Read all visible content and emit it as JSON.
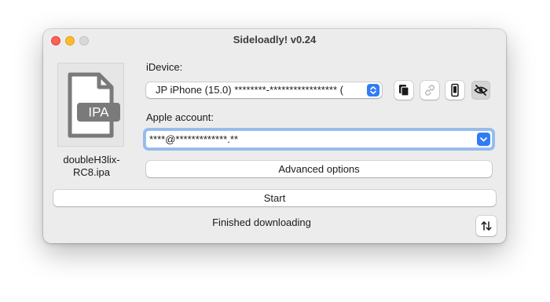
{
  "window": {
    "title": "Sideloadly! v0.24"
  },
  "file": {
    "icon_label": "IPA",
    "name": "doubleH3lix-RC8.ipa"
  },
  "idevice": {
    "label": "iDevice:",
    "selected": "JP iPhone (15.0) ********-***************** (",
    "icons": [
      "copy-icon",
      "link-icon",
      "phone-icon",
      "eye-slash-icon"
    ]
  },
  "apple_account": {
    "label": "Apple account:",
    "value": "****@*************.**"
  },
  "buttons": {
    "advanced": "Advanced options",
    "start": "Start"
  },
  "status": {
    "text": "Finished downloading"
  },
  "colors": {
    "accent": "#2f7cf6",
    "close": "#fe5f57",
    "minimize": "#febc2e"
  }
}
